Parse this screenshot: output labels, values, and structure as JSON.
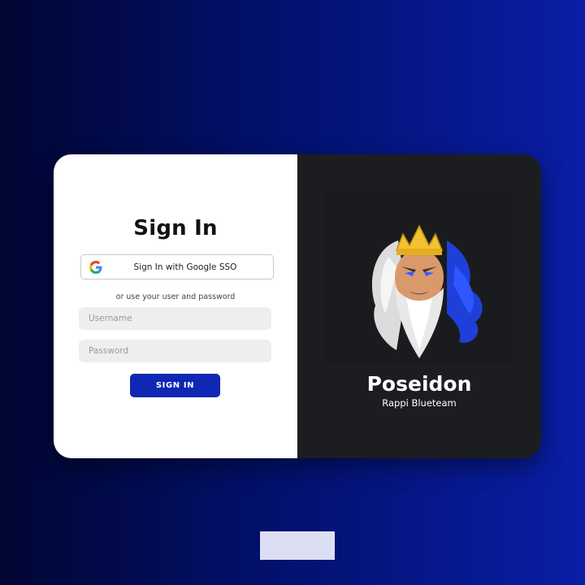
{
  "signin": {
    "title": "Sign In",
    "google_button_label": "Sign In with Google SSO",
    "or_text": "or use your user and password",
    "username_placeholder": "Username",
    "password_placeholder": "Password",
    "submit_label": "SIGN IN"
  },
  "brand": {
    "name": "Poseidon",
    "subtitle": "Rappi Blueteam",
    "logo_icon": "poseidon-logo"
  },
  "colors": {
    "primary_button": "#0f27b5",
    "panel_dark": "#1c1d20",
    "background_start": "#010633",
    "background_end": "#0a1ea6"
  }
}
